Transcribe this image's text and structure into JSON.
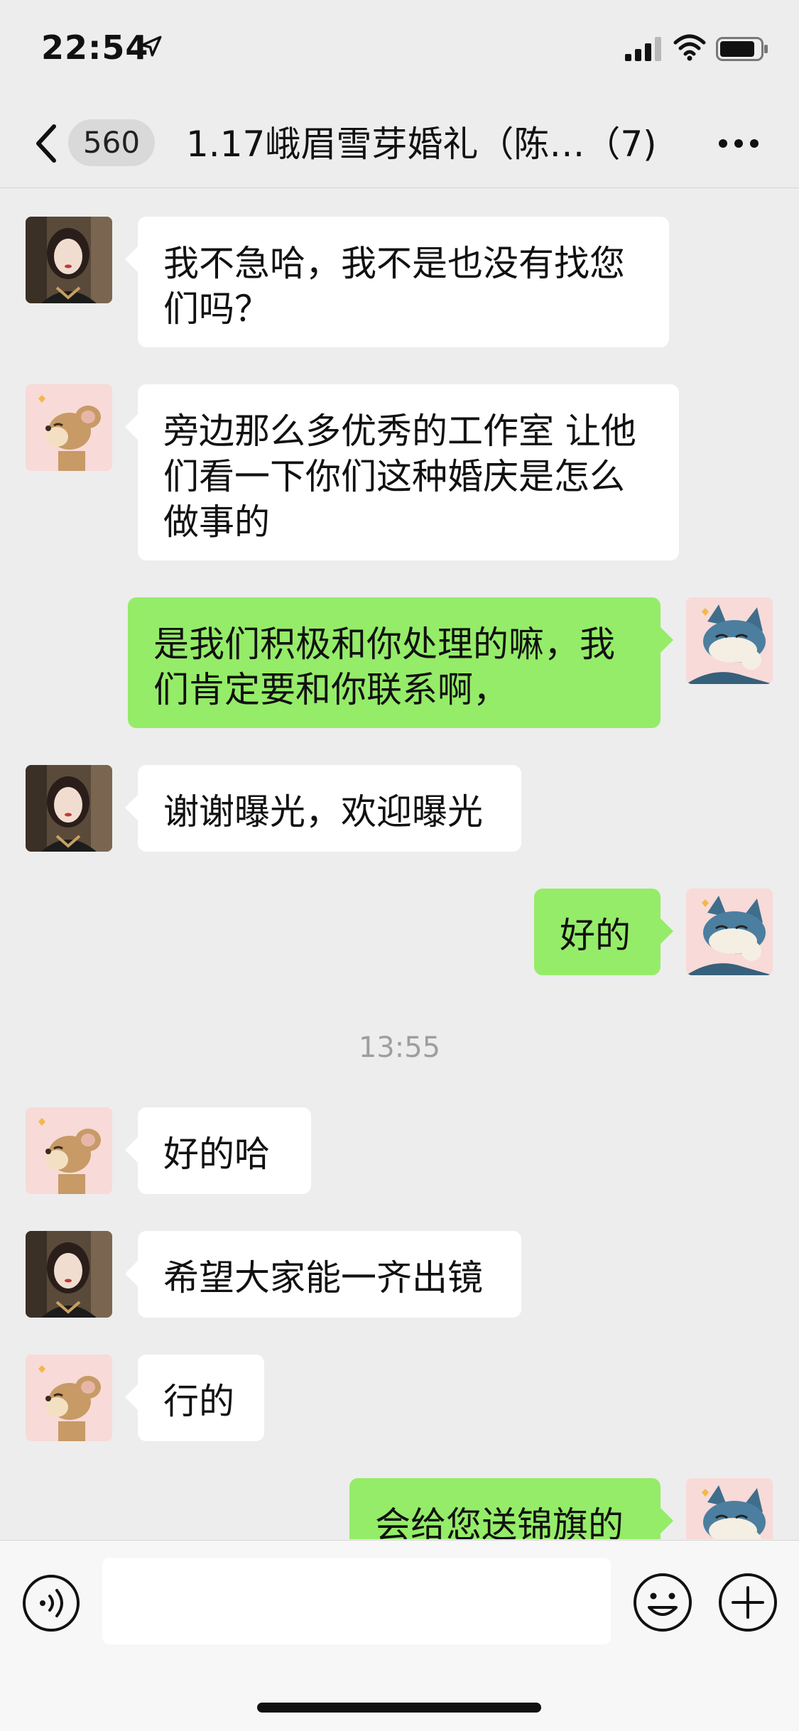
{
  "status_bar": {
    "time": "22:54",
    "icons": [
      "location-arrow-icon",
      "signal-icon",
      "wifi-icon",
      "battery-icon"
    ]
  },
  "nav": {
    "back_icon": "chevron-left-icon",
    "unread_count": "560",
    "title": "1.17峨眉雪芽婚礼（陈…（7)",
    "more_icon": "more-horizontal-icon"
  },
  "messages": [
    {
      "side": "left",
      "avatar": "avatar-woman",
      "text": "我不急哈，我不是也没有找您们吗？"
    },
    {
      "side": "left",
      "avatar": "avatar-jerry",
      "text": "旁边那么多优秀的工作室 让他们看一下你们这种婚庆是怎么做事的"
    },
    {
      "side": "right",
      "avatar": "avatar-tom",
      "text": "是我们积极和你处理的嘛，我们肯定要和你联系啊，"
    },
    {
      "side": "left",
      "avatar": "avatar-woman",
      "text": "谢谢曝光，欢迎曝光"
    },
    {
      "side": "right",
      "avatar": "avatar-tom",
      "text": "好的"
    },
    {
      "type": "time",
      "text": "13:55"
    },
    {
      "side": "left",
      "avatar": "avatar-jerry",
      "text": "好的哈"
    },
    {
      "side": "left",
      "avatar": "avatar-woman",
      "text": "希望大家能一齐出镜"
    },
    {
      "side": "left",
      "avatar": "avatar-jerry",
      "text": "行的"
    },
    {
      "side": "right",
      "avatar": "avatar-tom",
      "text": "会给您送锦旗的"
    }
  ],
  "input_bar": {
    "voice_icon": "voice-icon",
    "input_value": "",
    "emoji_icon": "emoji-icon",
    "plus_icon": "plus-circle-icon"
  },
  "colors": {
    "background": "#ededed",
    "bubble_self": "#95ec69",
    "bubble_other": "#ffffff",
    "timestamp": "#9e9e9e"
  }
}
